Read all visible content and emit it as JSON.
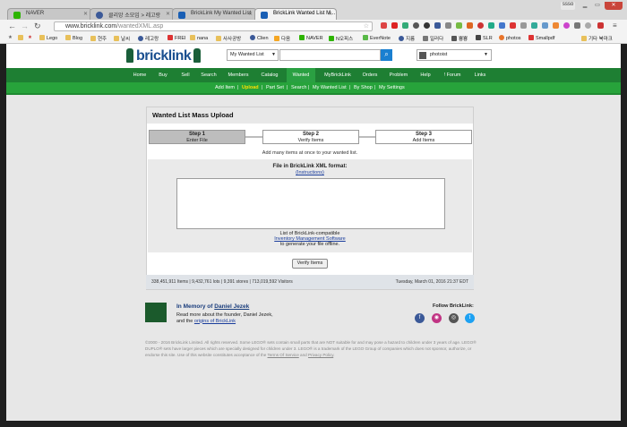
{
  "browser": {
    "tabs": [
      {
        "label": "NAVER",
        "fav_color": "#2db400"
      },
      {
        "label": "클리앙 소모임 > 레고랑",
        "fav_color": "#3b5998"
      },
      {
        "label": "BrickLink My Wanted List",
        "fav_color": "#1a5fb4"
      },
      {
        "label": "BrickLink Wanted List M...",
        "fav_color": "#1a5fb4"
      }
    ],
    "window_label": "ssso",
    "url_host": "www.bricklink.com",
    "url_path": "/wantedXML.asp",
    "bookmarks": [
      "Lego",
      "Blog",
      "현주",
      "날씨",
      "레고랑",
      "FREI",
      "nana",
      "사사공방",
      "Clien",
      "다음",
      "NAVER",
      "N오피스",
      "EverNote",
      "지름",
      "일러다",
      "뿅뿅",
      "SLR",
      "photos",
      "Smallpdf",
      "기타 북마크"
    ]
  },
  "header": {
    "logo_brick": "brick",
    "logo_link": "link",
    "search_select": "My Wanted List",
    "search_placeholder": "",
    "user_name": "photoist"
  },
  "nav": {
    "items": [
      "Home",
      "Buy",
      "Sell",
      "Search",
      "Members",
      "Catalog",
      "Wanted",
      "MyBrickLink",
      "Orders",
      "Problem",
      "Help",
      "! Forum",
      "Links"
    ],
    "active": "Wanted"
  },
  "subnav": {
    "items": [
      "Add Item",
      "Upload",
      "Part Set",
      "Search",
      "My Wanted List",
      "By Shop",
      "My Settings"
    ],
    "current": "Upload"
  },
  "upload": {
    "title": "Wanted List Mass Upload",
    "steps": [
      {
        "num": "Step 1",
        "label": "Enter File"
      },
      {
        "num": "Step 2",
        "label": "Verify Items"
      },
      {
        "num": "Step 3",
        "label": "Add Items"
      }
    ],
    "hint": "Add many items at once to your wanted list.",
    "panel_title": "File in BrickLink XML format:",
    "instructions_link": "(Instructions)",
    "note_line1": "List of BrickLink-compatible",
    "note_link": "Inventory Management Software",
    "note_line3": "to generate your file offline.",
    "verify_button": "Verify Items"
  },
  "stats": {
    "left": "338,451,911 Items | 9,432,761 lots | 9,391 stores | 713,019,592 Visitors",
    "right": "Tuesday, March 01, 2016 21:37 EDT"
  },
  "memory": {
    "prefix": "In Memory of ",
    "name": "Daniel Jezek",
    "line1": "Read more about the founder, Daniel Jezek,",
    "line2_prefix": "and the ",
    "line2_link": "origins of BrickLink"
  },
  "follow": {
    "label": "Follow BrickLink:",
    "networks": [
      {
        "name": "facebook-icon",
        "glyph": "f",
        "color": "#3b5998"
      },
      {
        "name": "instagram-icon",
        "glyph": "◉",
        "color": "#c13584"
      },
      {
        "name": "camera-icon",
        "glyph": "◎",
        "color": "#555555"
      },
      {
        "name": "twitter-icon",
        "glyph": "t",
        "color": "#1da1f2"
      }
    ]
  },
  "copyright": {
    "text": "©2000 - 2016 BrickLink Limited. All rights reserved. Some LEGO® sets contain small parts that are NOT suitable for and may pose a hazard to children under 3 years of age. LEGO® DUPLO® sets have larger pieces which are specially designed for children under 3. LEGO® is a trademark of the LEGO Group of companies which does not sponsor, authorize, or endorse this site. Use of this website constitutes acceptance of the ",
    "tos": "Terms Of Service",
    "and": " and ",
    "privacy": "Privacy Policy",
    "end": "."
  }
}
